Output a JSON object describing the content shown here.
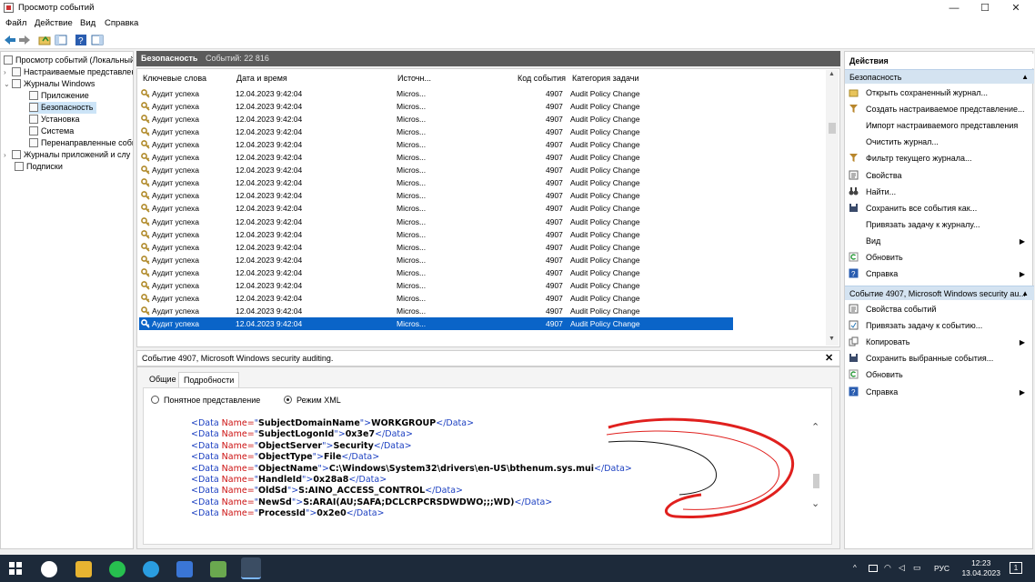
{
  "window": {
    "title": "Просмотр событий",
    "min": "—",
    "max": "☐",
    "close": "✕"
  },
  "menu": [
    "Файл",
    "Действие",
    "Вид",
    "Справка"
  ],
  "tree": {
    "root": "Просмотр событий (Локальный",
    "custom_views": "Настраиваемые представлен",
    "windows_logs": "Журналы Windows",
    "app": "Приложение",
    "security": "Безопасность",
    "setup": "Установка",
    "system": "Система",
    "forwarded": "Перенаправленные собы",
    "app_services": "Журналы приложений и слу",
    "subscriptions": "Подписки"
  },
  "list_header": {
    "name": "Безопасность",
    "count": "Событий: 22 816"
  },
  "columns": [
    "Ключевые слова",
    "Дата и время",
    "Источн...",
    "Код события",
    "Категория задачи"
  ],
  "rows": [
    {
      "keyword": "Аудит успеха",
      "date": "12.04.2023 9:42:04",
      "source": "Micros...",
      "id": "4907",
      "category": "Audit Policy Change"
    },
    {
      "keyword": "Аудит успеха",
      "date": "12.04.2023 9:42:04",
      "source": "Micros...",
      "id": "4907",
      "category": "Audit Policy Change"
    },
    {
      "keyword": "Аудит успеха",
      "date": "12.04.2023 9:42:04",
      "source": "Micros...",
      "id": "4907",
      "category": "Audit Policy Change"
    },
    {
      "keyword": "Аудит успеха",
      "date": "12.04.2023 9:42:04",
      "source": "Micros...",
      "id": "4907",
      "category": "Audit Policy Change"
    },
    {
      "keyword": "Аудит успеха",
      "date": "12.04.2023 9:42:04",
      "source": "Micros...",
      "id": "4907",
      "category": "Audit Policy Change"
    },
    {
      "keyword": "Аудит успеха",
      "date": "12.04.2023 9:42:04",
      "source": "Micros...",
      "id": "4907",
      "category": "Audit Policy Change"
    },
    {
      "keyword": "Аудит успеха",
      "date": "12.04.2023 9:42:04",
      "source": "Micros...",
      "id": "4907",
      "category": "Audit Policy Change"
    },
    {
      "keyword": "Аудит успеха",
      "date": "12.04.2023 9:42:04",
      "source": "Micros...",
      "id": "4907",
      "category": "Audit Policy Change"
    },
    {
      "keyword": "Аудит успеха",
      "date": "12.04.2023 9:42:04",
      "source": "Micros...",
      "id": "4907",
      "category": "Audit Policy Change"
    },
    {
      "keyword": "Аудит успеха",
      "date": "12.04.2023 9:42:04",
      "source": "Micros...",
      "id": "4907",
      "category": "Audit Policy Change"
    },
    {
      "keyword": "Аудит успеха",
      "date": "12.04.2023 9:42:04",
      "source": "Micros...",
      "id": "4907",
      "category": "Audit Policy Change"
    },
    {
      "keyword": "Аудит успеха",
      "date": "12.04.2023 9:42:04",
      "source": "Micros...",
      "id": "4907",
      "category": "Audit Policy Change"
    },
    {
      "keyword": "Аудит успеха",
      "date": "12.04.2023 9:42:04",
      "source": "Micros...",
      "id": "4907",
      "category": "Audit Policy Change"
    },
    {
      "keyword": "Аудит успеха",
      "date": "12.04.2023 9:42:04",
      "source": "Micros...",
      "id": "4907",
      "category": "Audit Policy Change"
    },
    {
      "keyword": "Аудит успеха",
      "date": "12.04.2023 9:42:04",
      "source": "Micros...",
      "id": "4907",
      "category": "Audit Policy Change"
    },
    {
      "keyword": "Аудит успеха",
      "date": "12.04.2023 9:42:04",
      "source": "Micros...",
      "id": "4907",
      "category": "Audit Policy Change"
    },
    {
      "keyword": "Аудит успеха",
      "date": "12.04.2023 9:42:04",
      "source": "Micros...",
      "id": "4907",
      "category": "Audit Policy Change"
    },
    {
      "keyword": "Аудит успеха",
      "date": "12.04.2023 9:42:04",
      "source": "Micros...",
      "id": "4907",
      "category": "Audit Policy Change"
    },
    {
      "keyword": "Аудит успеха",
      "date": "12.04.2023 9:42:04",
      "source": "Micros...",
      "id": "4907",
      "category": "Audit Policy Change"
    }
  ],
  "detail": {
    "title": "Событие 4907, Microsoft Windows security auditing.",
    "tab_general": "Общие",
    "tab_details": "Подробности",
    "radio_friendly": "Понятное представление",
    "radio_xml": "Режим XML"
  },
  "xml": [
    {
      "name": "SubjectDomainName",
      "value": "WORKGROUP"
    },
    {
      "name": "SubjectLogonId",
      "value": "0x3e7"
    },
    {
      "name": "ObjectServer",
      "value": "Security"
    },
    {
      "name": "ObjectType",
      "value": "File"
    },
    {
      "name": "ObjectName",
      "value": "C:\\Windows\\System32\\drivers\\en-US\\bthenum.sys.mui"
    },
    {
      "name": "HandleId",
      "value": "0x28a8"
    },
    {
      "name": "OldSd",
      "value": "S:AINO_ACCESS_CONTROL"
    },
    {
      "name": "NewSd",
      "value": "S:ARAI(AU;SAFA;DCLCRPCRSDWDWO;;;WD)"
    },
    {
      "name": "ProcessId",
      "value": "0x2e0"
    }
  ],
  "xml_tokens": {
    "open": "<Data ",
    "attr": "Name=",
    "close_open": "</",
    "close_tag": "Data",
    "gt": ">",
    "q": "\""
  },
  "actions": {
    "header": "Действия",
    "section1": "Безопасность",
    "items1": [
      {
        "label": "Открыть сохраненный журнал...",
        "icon": "folder-open-icon",
        "sub": false
      },
      {
        "label": "Создать настраиваемое представление...",
        "icon": "filter-icon",
        "sub": false
      },
      {
        "label": "Импорт настраиваемого представления",
        "icon": "",
        "sub": false
      },
      {
        "label": "Очистить журнал...",
        "icon": "",
        "sub": false
      },
      {
        "label": "Фильтр текущего журнала...",
        "icon": "filter-icon",
        "sub": false
      },
      {
        "label": "Свойства",
        "icon": "properties-icon",
        "sub": false
      },
      {
        "label": "Найти...",
        "icon": "binoculars-icon",
        "sub": false
      },
      {
        "label": "Сохранить все события как...",
        "icon": "save-icon",
        "sub": false
      },
      {
        "label": "Привязать задачу к журналу...",
        "icon": "",
        "sub": false
      },
      {
        "label": "Вид",
        "icon": "",
        "sub": true
      },
      {
        "label": "Обновить",
        "icon": "refresh-icon",
        "sub": false
      },
      {
        "label": "Справка",
        "icon": "help-icon",
        "sub": true
      }
    ],
    "section2": "Событие 4907, Microsoft Windows security au...",
    "items2": [
      {
        "label": "Свойства событий",
        "icon": "properties-icon",
        "sub": false
      },
      {
        "label": "Привязать задачу к событию...",
        "icon": "task-icon",
        "sub": false
      },
      {
        "label": "Копировать",
        "icon": "copy-icon",
        "sub": true
      },
      {
        "label": "Сохранить выбранные события...",
        "icon": "save-icon",
        "sub": false
      },
      {
        "label": "Обновить",
        "icon": "refresh-icon",
        "sub": false
      },
      {
        "label": "Справка",
        "icon": "help-icon",
        "sub": true
      }
    ]
  },
  "taskbar": {
    "lang": "РУС",
    "time": "12:23",
    "date": "13.04.2023",
    "notif": "1"
  },
  "colors": {
    "selection": "#0a64c8",
    "section_blue": "#d4e3f1",
    "header_dark": "#5b5b5b",
    "annotation_red": "#e0201e"
  }
}
